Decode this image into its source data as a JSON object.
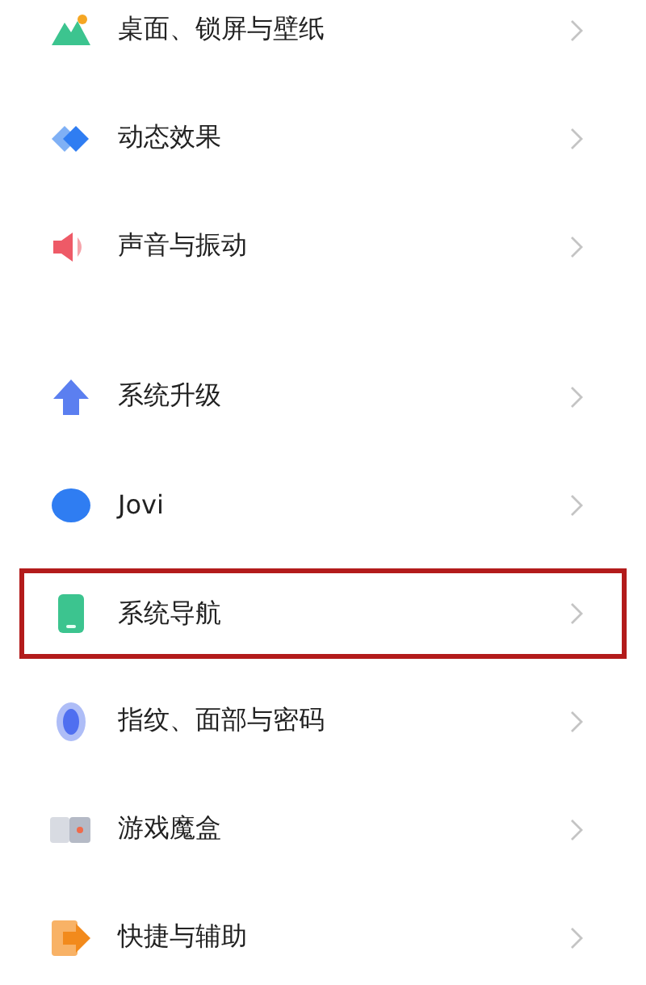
{
  "groups": [
    {
      "items": [
        {
          "label": "桌面、锁屏与壁纸",
          "highlighted": false
        },
        {
          "label": "动态效果",
          "highlighted": false
        },
        {
          "label": "声音与振动",
          "highlighted": false
        }
      ]
    },
    {
      "items": [
        {
          "label": "系统升级",
          "highlighted": false
        },
        {
          "label": "Jovi",
          "highlighted": false
        },
        {
          "label": "系统导航",
          "highlighted": true
        },
        {
          "label": "指纹、面部与密码",
          "highlighted": false
        },
        {
          "label": "游戏魔盒",
          "highlighted": false
        },
        {
          "label": "快捷与辅助",
          "highlighted": false
        }
      ]
    }
  ]
}
